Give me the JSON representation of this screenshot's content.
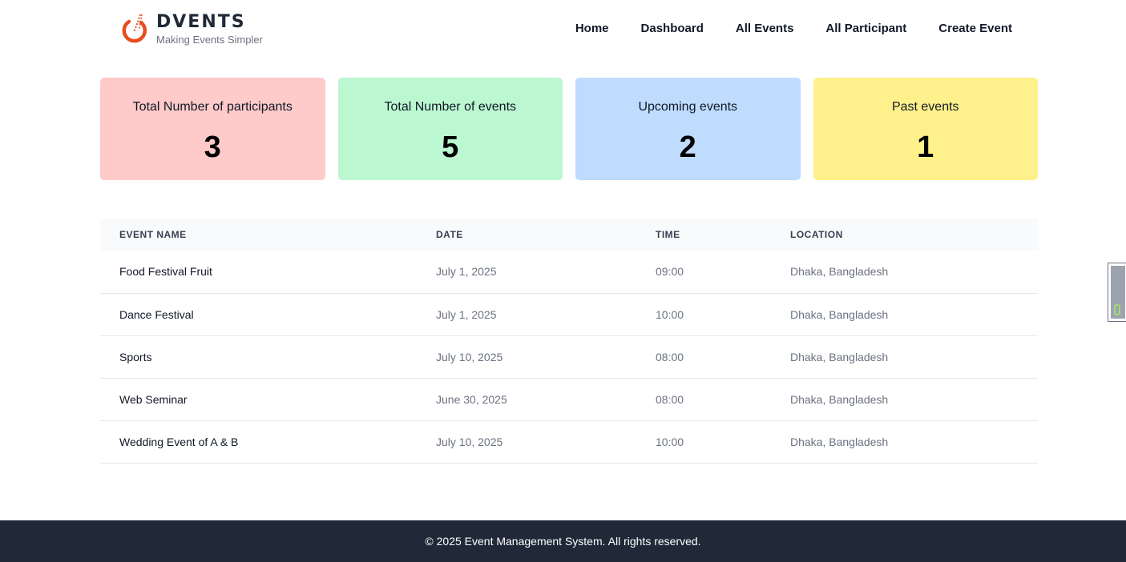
{
  "brand": {
    "name": "DVENTS",
    "tagline": "Making Events Simpler",
    "logo_icon": "torch-logo-icon",
    "accent_color": "#ea4c1d"
  },
  "nav": {
    "items": [
      {
        "label": "Home"
      },
      {
        "label": "Dashboard"
      },
      {
        "label": "All Events"
      },
      {
        "label": "All Participant"
      },
      {
        "label": "Create Event"
      }
    ]
  },
  "stats": [
    {
      "label": "Total Number of participants",
      "value": "3",
      "color": "#fecaca"
    },
    {
      "label": "Total Number of events",
      "value": "5",
      "color": "#bbf7d0"
    },
    {
      "label": "Upcoming events",
      "value": "2",
      "color": "#bfdbfe"
    },
    {
      "label": "Past events",
      "value": "1",
      "color": "#fef08a"
    }
  ],
  "table": {
    "headers": [
      "EVENT NAME",
      "DATE",
      "TIME",
      "LOCATION"
    ],
    "rows": [
      {
        "name": "Food Festival Fruit",
        "date": "July 1, 2025",
        "time": "09:00",
        "location": "Dhaka, Bangladesh"
      },
      {
        "name": "Dance Festival",
        "date": "July 1, 2025",
        "time": "10:00",
        "location": "Dhaka, Bangladesh"
      },
      {
        "name": "Sports",
        "date": "July 10, 2025",
        "time": "08:00",
        "location": "Dhaka, Bangladesh"
      },
      {
        "name": "Web Seminar",
        "date": "June 30, 2025",
        "time": "08:00",
        "location": "Dhaka, Bangladesh"
      },
      {
        "name": "Wedding Event of A & B",
        "date": "July 10, 2025",
        "time": "10:00",
        "location": "Dhaka, Bangladesh"
      }
    ]
  },
  "footer": {
    "text": "© 2025 Event Management System. All rights reserved.",
    "background": "#1f2937"
  },
  "side_widget": {
    "icon": "extension-widget-icon"
  }
}
